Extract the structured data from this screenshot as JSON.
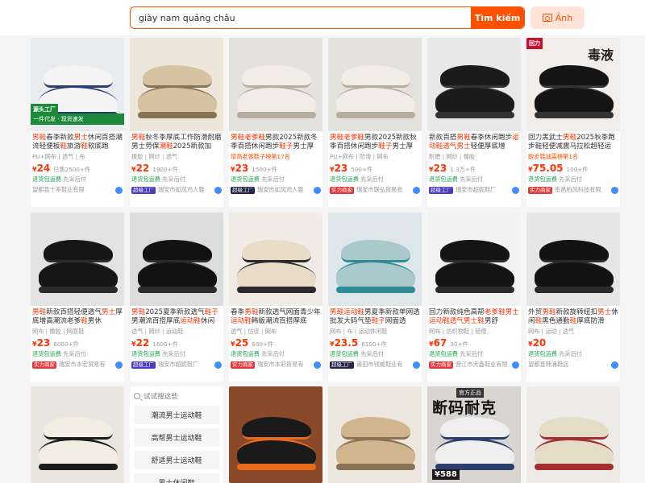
{
  "search": {
    "value": "giày nam quảng châu",
    "button_label": "Tìm kiếm",
    "image_button_label": "Ảnh"
  },
  "products": [
    {
      "title_parts": [
        "男",
        "鞋",
        "春季新款",
        "男士",
        "休闲百搭潮流轻便板",
        "鞋",
        "旅游",
        "鞋",
        "软底跑"
      ],
      "tags": "PU+网布 | 透气 | 布",
      "price": "24",
      "sold": "已售2500+件",
      "meta": "退货包运费 先采后付",
      "shop": "望都县十率鞋业有限",
      "badge": "",
      "badge_type": "",
      "overlay": "源头工厂",
      "overlay2": "一件代发 · 现货速发",
      "bg": "#e9ecef",
      "shoe": "#f4f4f4",
      "accent": "#2c3e6e"
    },
    {
      "title_parts": [
        "男",
        "鞋",
        "秋冬季厚底工作防滑耐磨男士劳保",
        "潮鞋",
        "2025新款加"
      ],
      "tags": "橡胶 | 网纱 | 透气",
      "price": "22",
      "sold": "1900+件",
      "meta": "退货包运费 先采后付",
      "shop": "瑞安市如风鸡人鞋",
      "badge": "超级工厂",
      "badge_type": "purple",
      "overlay": "",
      "overlay2": "",
      "bg": "#ede6db",
      "shoe": "#d6c3a2",
      "accent": "#8a7354"
    },
    {
      "title_parts": [
        "男",
        "鞋",
        "老爹",
        "鞋",
        "男款2025新款冬季百搭休闲跑步",
        "鞋子",
        "男士厚"
      ],
      "tags": "增高老爹鞋子榜第17名",
      "price": "23",
      "sold": "1500+件",
      "meta": "退货包运费 先采后付",
      "shop": "瑞安市如风鸡人鞋",
      "badge": "超级工厂",
      "badge_type": "dark",
      "overlay": "",
      "overlay2": "",
      "bg": "#e4e2df",
      "shoe": "#f1ede6",
      "accent": "#b8ad9c"
    },
    {
      "title_parts": [
        "男",
        "鞋",
        "老爹",
        "鞋",
        "男款2025新款秋季百搭休闲跑步",
        "鞋子",
        "男士厚"
      ],
      "tags": "PU+网布 | 防滑 | 网布",
      "price": "23",
      "sold": "500+件",
      "meta": "退货包运费 先采后付",
      "shop": "瑞安市联弘贸易有",
      "badge": "实力商家",
      "badge_type": "red",
      "overlay": "",
      "overlay2": "",
      "bg": "#e4e2df",
      "shoe": "#f1ede6",
      "accent": "#b8ad9c"
    },
    {
      "title_parts": [
        "新款百搭",
        "男",
        "鞋",
        "春季休闲跑步",
        "运动鞋",
        "透气",
        "男士",
        "轻便厚底增"
      ],
      "tags": "耐磨 | 网纱 | 橡胶",
      "price": "23",
      "sold": "1.3万+件",
      "meta": "退货包运费 先采后付",
      "shop": "瑞安市超妮鞋厂",
      "badge": "超级工厂",
      "badge_type": "purple",
      "overlay": "",
      "overlay2": "",
      "bg": "#e8e8e8",
      "shoe": "#1b1b1b",
      "accent": "#333"
    },
    {
      "title_parts": [
        "回力黑武士",
        "男",
        "鞋",
        "2025秋季跑步鞋轻便减震马拉松超轻运"
      ],
      "tags": "跑步鞋减震榜第1名",
      "price": "75.05",
      "sold": "100+件",
      "meta": "退货包运费 先采后付",
      "shop": "南昌柏风科技有限",
      "badge": "实力商家",
      "badge_type": "red",
      "overlay": "回力",
      "overlay2": "",
      "bg": "#f1eeea",
      "shoe": "#151515",
      "accent": "#333",
      "bigtext": "毒液"
    },
    {
      "title_parts": [
        "男",
        "鞋",
        "新款百搭轻便透气",
        "男士",
        "厚底增高潮流老爹",
        "鞋",
        "男休"
      ],
      "tags": "网布 | 橡胶 | 网面鞋",
      "price": "23",
      "sold": "6000+件",
      "meta": "退货包运费 先采后付",
      "shop": "瑞安市本宏贸易有",
      "badge": "实力商家",
      "badge_type": "red",
      "overlay": "",
      "overlay2": "",
      "bg": "#e3e3e3",
      "shoe": "#161616",
      "accent": "#2b2b2b"
    },
    {
      "title_parts": [
        "男",
        "鞋",
        "2025夏季新款透气",
        "鞋子",
        "男潮流百搭厚底",
        "运动鞋",
        "休闲"
      ],
      "tags": "透气 | 网纱 | 运动鞋",
      "price": "22",
      "sold": "1600+件",
      "meta": "退货包运费 先采后付",
      "shop": "瑞安市超妮鞋厂",
      "badge": "超级工厂",
      "badge_type": "purple",
      "overlay": "",
      "overlay2": "",
      "bg": "#dcdcdc",
      "shoe": "#121212",
      "accent": "#2b2b2b"
    },
    {
      "title_parts": [
        "春季",
        "男",
        "鞋",
        "新款透气网面青少年",
        "运动鞋",
        "韩版潮流百搭厚底"
      ],
      "tags": "透气 | 仿皮 | 网布",
      "price": "25",
      "sold": "600+件",
      "meta": "退货包运费 先采后付",
      "shop": "瑞安市本彩贸易有",
      "badge": "实力商家",
      "badge_type": "red",
      "overlay": "",
      "overlay2": "",
      "bg": "#f0ebe4",
      "shoe": "#e8dcc8",
      "accent": "#2a2a2a"
    },
    {
      "title_parts": [
        "男",
        "鞋",
        "运动鞋",
        "男夏季新款单网透批发大码气垫",
        "鞋子",
        "网面透"
      ],
      "tags": "网布 | 布 | 运动休闲鞋",
      "price": "23.5",
      "sold": "6100+件",
      "meta": "退货包运费 先采后付",
      "shop": "莆田市钱威鞋业有",
      "badge": "超级工厂",
      "badge_type": "dark",
      "overlay": "",
      "overlay2": "",
      "bg": "#dfe6ea",
      "shoe": "#a9c9cc",
      "accent": "#2f8b95"
    },
    {
      "title_parts": [
        "回力新款纯色高帮",
        "老爹",
        "鞋",
        "男士",
        "运动鞋",
        "透气",
        "男士",
        "鞋",
        "男舒"
      ],
      "tags": "网布 | 仿织物鞋 | 轻便",
      "price": "67",
      "sold": "30+件",
      "meta": "退货包运费 先采后付",
      "shop": "晋江市天鑫鞋业有限",
      "badge": "实力商家",
      "badge_type": "red",
      "overlay": "",
      "overlay2": "",
      "bg": "#f2f2f2",
      "shoe": "#141414",
      "accent": "#2b2b2b"
    },
    {
      "title_parts": [
        "外贸",
        "男",
        "鞋",
        "新款旋转纽扣",
        "男士",
        "休闲",
        "鞋",
        "黑色通勤",
        "鞋",
        "厚底防滑"
      ],
      "tags": "网布 | 运动 | 透气",
      "price": "20",
      "sold": "",
      "meta": "退货包运费 先采后付",
      "shop": "望都县韩涌鞋店",
      "badge": "",
      "badge_type": "",
      "overlay": "",
      "overlay2": "",
      "bg": "#e6e6e6",
      "shoe": "#131313",
      "accent": "#2b2b2b"
    }
  ],
  "bottom_thumbs": [
    {
      "bg": "#e9e6e2",
      "shoe": "#f2ede3",
      "accent": "#1c1c1c",
      "text": ""
    },
    {
      "bg": "#8a4a2a",
      "shoe": "#1a1a1a",
      "accent": "#e96a1a",
      "text": ""
    },
    {
      "bg": "#ece7df",
      "shoe": "#d1b58f",
      "accent": "#8a7354",
      "text": ""
    },
    {
      "bg": "#d8d5d1",
      "shoe": "#eeeeee",
      "accent": "#2c3e6e",
      "text": "断码耐克",
      "price_tag": "¥588",
      "tag": "官方正品"
    },
    {
      "bg": "#ecebe8",
      "shoe": "#e5dcc8",
      "accent": "#a33030",
      "text": ""
    }
  ],
  "suggestions": {
    "head": "试试搜这些",
    "items": [
      "潮流男士运动鞋",
      "高帮男士运动鞋",
      "舒适男士运动鞋",
      "男士休闲鞋"
    ]
  },
  "colors": {
    "accent": "#ff5000",
    "price": "#ff3300",
    "green": "#1aa34a"
  }
}
